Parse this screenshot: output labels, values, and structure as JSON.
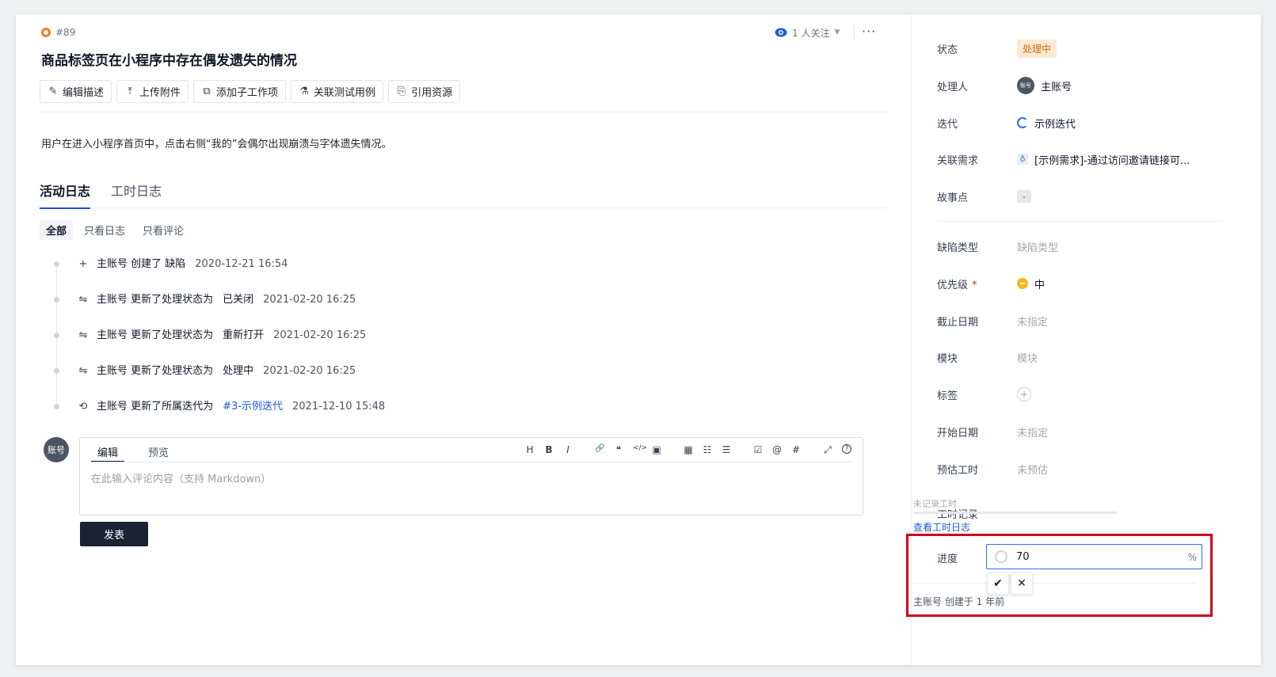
{
  "issue": {
    "id": "#89",
    "title": "商品标签页在小程序中存在偶发遗失的情况",
    "watch_label": "1 人关注",
    "description": "用户在进入小程序首页中，点击右侧“我的”会偶尔出现崩溃与字体遗失情况。"
  },
  "toolbar": {
    "buttons": [
      {
        "label": "编辑描述",
        "icon": "pencil-icon"
      },
      {
        "label": "上传附件",
        "icon": "upload-icon"
      },
      {
        "label": "添加子工作项",
        "icon": "subtask-icon"
      },
      {
        "label": "关联测试用例",
        "icon": "flask-icon"
      },
      {
        "label": "引用资源",
        "icon": "reference-icon"
      }
    ]
  },
  "tabs": {
    "activity": "活动日志",
    "worklog": "工时日志"
  },
  "filters": {
    "all": "全部",
    "logs_only": "只看日志",
    "comments_only": "只看评论"
  },
  "timeline": [
    {
      "icon": "plus-icon",
      "text": "主账号 创建了 缺陷",
      "value": "",
      "link": "",
      "time": "2020-12-21 16:54"
    },
    {
      "icon": "swap-icon",
      "text": "主账号 更新了处理状态为",
      "value": "已关闭",
      "link": "",
      "time": "2021-02-20 16:25"
    },
    {
      "icon": "swap-icon",
      "text": "主账号 更新了处理状态为",
      "value": "重新打开",
      "link": "",
      "time": "2021-02-20 16:25"
    },
    {
      "icon": "swap-icon",
      "text": "主账号 更新了处理状态为",
      "value": "处理中",
      "link": "",
      "time": "2021-02-20 16:25"
    },
    {
      "icon": "sprint-icon",
      "text": "主账号 更新了所属迭代为",
      "value": "",
      "link": "#3-示例迭代",
      "time": "2021-12-10 15:48"
    }
  ],
  "comment": {
    "avatar": "账号",
    "tab_edit": "编辑",
    "tab_preview": "预览",
    "placeholder": "在此输入评论内容（支持 Markdown）",
    "tools": [
      "H",
      "B",
      "I",
      "🔗",
      "❝",
      "</>",
      "▣",
      "▦",
      "☷",
      "☰",
      "☑",
      "@",
      "#",
      "⤢",
      "?"
    ],
    "publish": "发表"
  },
  "side": {
    "status_label": "状态",
    "status_value": "处理中",
    "assignee_label": "处理人",
    "assignee_avatar": "账号",
    "assignee_value": "主账号",
    "sprint_label": "迭代",
    "sprint_value": "示例迭代",
    "req_label": "关联需求",
    "req_value": "[示例需求]-通过访问邀请链接可...",
    "story_label": "故事点",
    "story_value": "-",
    "type_label": "缺陷类型",
    "type_value": "缺陷类型",
    "priority_label": "优先级",
    "priority_star": "*",
    "priority_value": "中",
    "due_label": "截止日期",
    "due_value": "未指定",
    "module_label": "模块",
    "module_value": "模块",
    "tags_label": "标签",
    "tags_add": "+",
    "start_label": "开始日期",
    "start_value": "未指定",
    "estimate_label": "预估工时",
    "estimate_value": "未预估",
    "worklog_label": "工时记录",
    "worklog_empty": "未记录工时",
    "worklog_link": "查看工时日志",
    "progress_label": "进度",
    "progress_value": "70",
    "progress_unit": "%",
    "created_text": "主账号 创建于 1 年前"
  },
  "colors": {
    "accent": "#1d5bd8",
    "status_orange": "#d46b08",
    "priority_yellow": "#f5b917",
    "highlight_red": "#d0021b"
  }
}
